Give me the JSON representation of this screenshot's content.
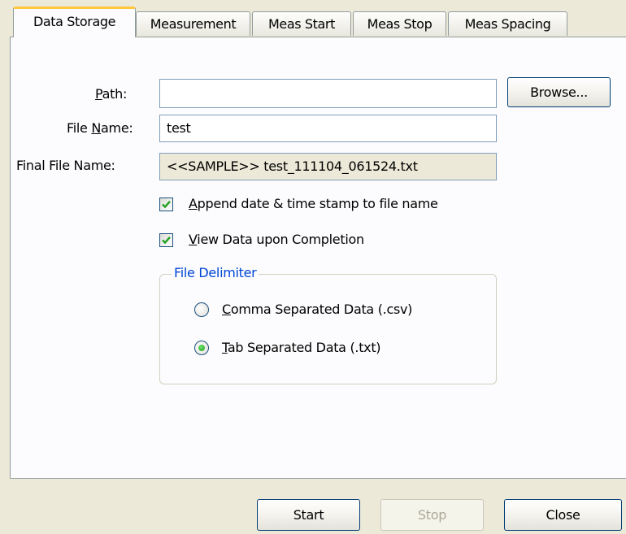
{
  "tabs": [
    {
      "label": "Data Storage",
      "active": true
    },
    {
      "label": "Measurement",
      "active": false
    },
    {
      "label": "Meas Start",
      "active": false
    },
    {
      "label": "Meas Stop",
      "active": false
    },
    {
      "label": "Meas Spacing",
      "active": false
    }
  ],
  "form": {
    "path_label_prefix": "",
    "path_label_hotkey": "P",
    "path_label_rest": "ath:",
    "path_value": "",
    "browse_label": "Browse...",
    "filename_label_prefix": "File ",
    "filename_label_hotkey": "N",
    "filename_label_rest": "ame:",
    "filename_value": "test",
    "final_label": "Final File Name:",
    "final_value": "<<SAMPLE>> test_111104_061524.txt"
  },
  "options": {
    "append_hotkey": "A",
    "append_rest": "ppend date & time stamp to file name",
    "append_checked": true,
    "view_hotkey": "V",
    "view_rest": "iew Data upon Completion",
    "view_checked": true
  },
  "delimiter": {
    "title": "File Delimiter",
    "comma_hotkey": "C",
    "comma_rest": "omma Separated Data (.csv)",
    "tab_hotkey": "T",
    "tab_rest": "ab Separated Data (.txt)",
    "selected": "tab"
  },
  "footer": {
    "start_label": "Start",
    "stop_label": "Stop",
    "close_label": "Close"
  },
  "colors": {
    "active_tab_accent": "#ffc83c",
    "group_title": "#0046d5",
    "check_mark": "#21a121"
  }
}
